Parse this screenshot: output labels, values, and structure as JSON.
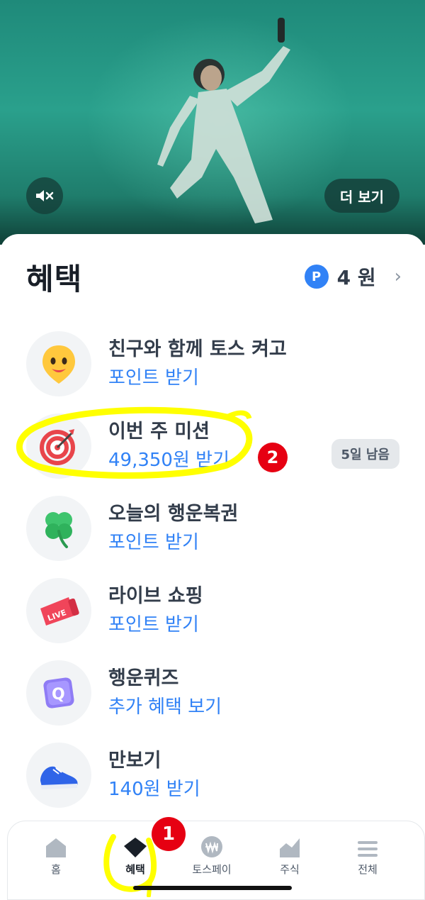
{
  "hero": {
    "more_label": "더 보기"
  },
  "header": {
    "title": "혜택",
    "points_badge": "P",
    "points_value": "4 원",
    "chevron": "›"
  },
  "items": [
    {
      "title": "친구와 함께 토스 켜고",
      "sub": "포인트 받기",
      "icon": "smiley-pin-icon"
    },
    {
      "title": "이번 주 미션",
      "sub": "49,350원 받기",
      "icon": "target-dart-icon",
      "pill": "5일 남음"
    },
    {
      "title": "오늘의 행운복권",
      "sub": "포인트 받기",
      "icon": "clover-icon"
    },
    {
      "title": "라이브 쇼핑",
      "sub": "포인트 받기",
      "icon": "live-megaphone-icon"
    },
    {
      "title": "행운퀴즈",
      "sub": "추가 혜택 보기",
      "icon": "quiz-q-icon"
    },
    {
      "title": "만보기",
      "sub": "140원 받기",
      "icon": "sneaker-icon"
    }
  ],
  "annotations": {
    "badge1": "1",
    "badge2": "2"
  },
  "tabs": [
    {
      "label": "홈",
      "icon": "home-icon"
    },
    {
      "label": "혜택",
      "icon": "gem-icon",
      "active": true
    },
    {
      "label": "토스페이",
      "icon": "won-coin-icon"
    },
    {
      "label": "주식",
      "icon": "stock-chart-icon"
    },
    {
      "label": "전체",
      "icon": "menu-icon"
    }
  ],
  "colors": {
    "accent": "#3182f6",
    "highlight": "#ffff00",
    "badge_red": "#e60012"
  }
}
